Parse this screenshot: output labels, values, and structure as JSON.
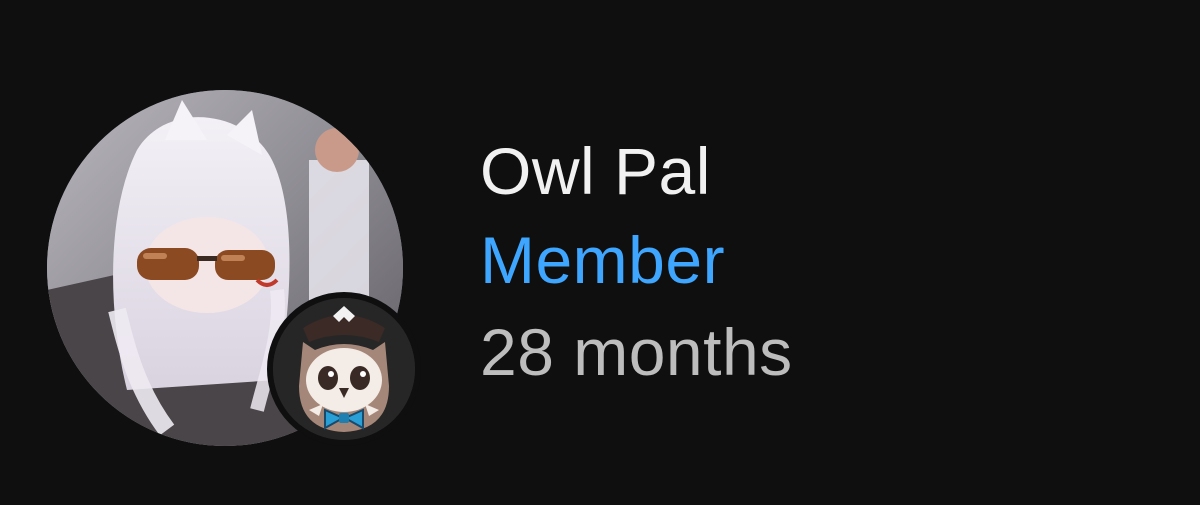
{
  "member": {
    "name": "Owl Pal",
    "status": "Member",
    "duration": "28 months"
  },
  "avatar": {
    "icon": "anime-character-with-sunglasses"
  },
  "badge": {
    "icon": "owl-membership-badge-icon"
  },
  "colors": {
    "background": "#0f0f0f",
    "name": "#f1f1f1",
    "status": "#3ea6ff",
    "duration": "#bdbdbd"
  }
}
